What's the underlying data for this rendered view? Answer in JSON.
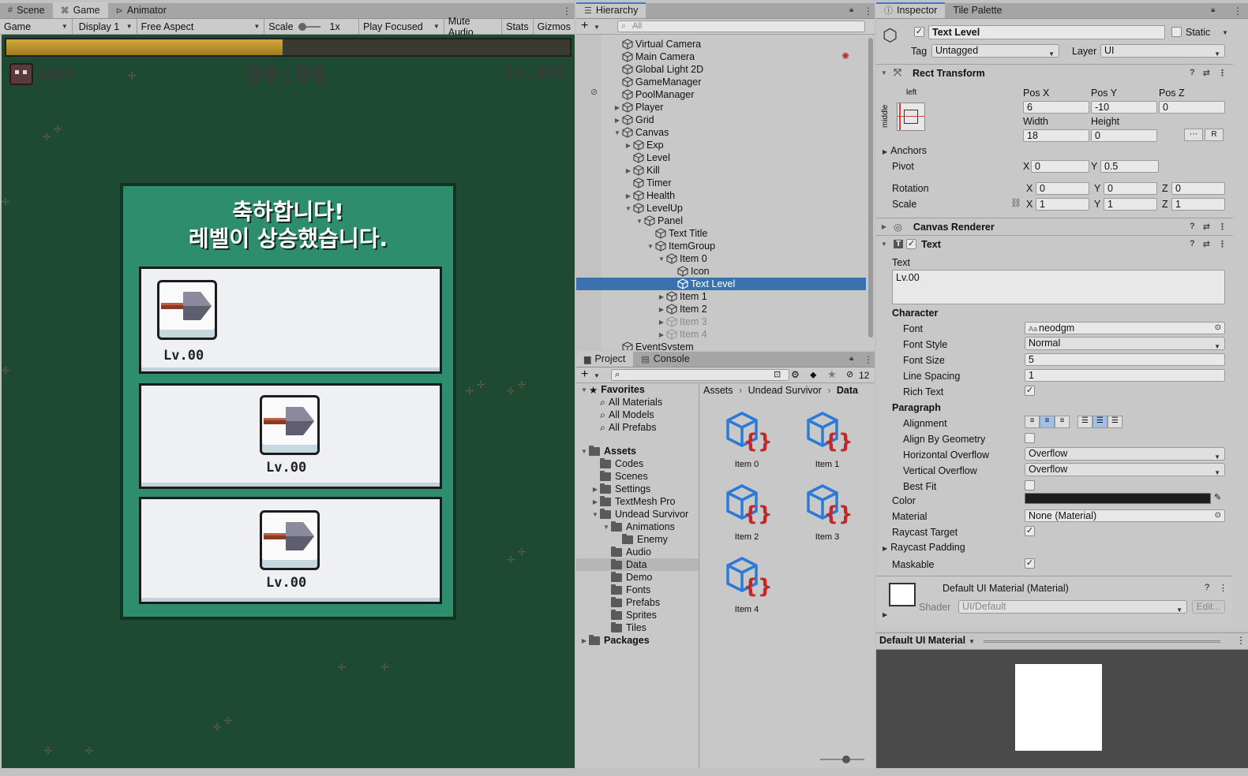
{
  "game": {
    "tabs": [
      {
        "label": "Scene"
      },
      {
        "label": "Game"
      },
      {
        "label": "Animator"
      }
    ],
    "toolbar": {
      "view": "Game",
      "display": "Display 1",
      "aspect": "Free Aspect",
      "scale_label": "Scale",
      "scale_value": "1x",
      "play_focused": "Play Focused",
      "mute": "Mute Audio",
      "stats": "Stats",
      "gizmos": "Gizmos"
    },
    "hud": {
      "kills": "9999",
      "timer": "00:00",
      "level": "Lv.999",
      "exp_fill": 0.49
    },
    "panel": {
      "title_line1": "축하합니다!",
      "title_line2": "레벨이 상승했습니다.",
      "items": [
        {
          "level": "Lv.00"
        },
        {
          "level": "Lv.00"
        },
        {
          "level": "Lv.00"
        }
      ]
    }
  },
  "hierarchy": {
    "tab": "Hierarchy",
    "search_placeholder": "All",
    "rows": [
      {
        "label": "Virtual Camera",
        "depth": 0,
        "fold": ""
      },
      {
        "label": "Main Camera",
        "depth": 0,
        "fold": ""
      },
      {
        "label": "Global Light 2D",
        "depth": 0,
        "fold": ""
      },
      {
        "label": "GameManager",
        "depth": 0,
        "fold": ""
      },
      {
        "label": "PoolManager",
        "depth": 0,
        "fold": ""
      },
      {
        "label": "Player",
        "depth": 0,
        "fold": "▶"
      },
      {
        "label": "Grid",
        "depth": 0,
        "fold": "▶"
      },
      {
        "label": "Canvas",
        "depth": 0,
        "fold": "▼"
      },
      {
        "label": "Exp",
        "depth": 1,
        "fold": "▶"
      },
      {
        "label": "Level",
        "depth": 1,
        "fold": ""
      },
      {
        "label": "Kill",
        "depth": 1,
        "fold": "▶"
      },
      {
        "label": "Timer",
        "depth": 1,
        "fold": ""
      },
      {
        "label": "Health",
        "depth": 1,
        "fold": "▶"
      },
      {
        "label": "LevelUp",
        "depth": 1,
        "fold": "▼"
      },
      {
        "label": "Panel",
        "depth": 2,
        "fold": "▼"
      },
      {
        "label": "Text Title",
        "depth": 3,
        "fold": ""
      },
      {
        "label": "ItemGroup",
        "depth": 3,
        "fold": "▼"
      },
      {
        "label": "Item 0",
        "depth": 4,
        "fold": "▼"
      },
      {
        "label": "Icon",
        "depth": 5,
        "fold": ""
      },
      {
        "label": "Text Level",
        "depth": 5,
        "fold": "",
        "selected": true
      },
      {
        "label": "Item 1",
        "depth": 4,
        "fold": "▶"
      },
      {
        "label": "Item 2",
        "depth": 4,
        "fold": "▶"
      },
      {
        "label": "Item 3",
        "depth": 4,
        "fold": "▶",
        "inactive": true
      },
      {
        "label": "Item 4",
        "depth": 4,
        "fold": "▶",
        "inactive": true
      },
      {
        "label": "EventSystem",
        "depth": 0,
        "fold": ""
      }
    ]
  },
  "project": {
    "tabs": [
      {
        "label": "Project"
      },
      {
        "label": "Console"
      }
    ],
    "hidden_count": "12",
    "favorites": {
      "label": "Favorites",
      "items": [
        "All Materials",
        "All Models",
        "All Prefabs"
      ]
    },
    "tree": [
      {
        "label": "Assets",
        "depth": 0,
        "fold": "▼",
        "bold": true
      },
      {
        "label": "Codes",
        "depth": 1,
        "fold": ""
      },
      {
        "label": "Scenes",
        "depth": 1,
        "fold": ""
      },
      {
        "label": "Settings",
        "depth": 1,
        "fold": "▶"
      },
      {
        "label": "TextMesh Pro",
        "depth": 1,
        "fold": "▶"
      },
      {
        "label": "Undead Survivor",
        "depth": 1,
        "fold": "▼"
      },
      {
        "label": "Animations",
        "depth": 2,
        "fold": "▼"
      },
      {
        "label": "Enemy",
        "depth": 3,
        "fold": ""
      },
      {
        "label": "Audio",
        "depth": 2,
        "fold": ""
      },
      {
        "label": "Data",
        "depth": 2,
        "fold": "",
        "selected": true
      },
      {
        "label": "Demo",
        "depth": 2,
        "fold": ""
      },
      {
        "label": "Fonts",
        "depth": 2,
        "fold": ""
      },
      {
        "label": "Prefabs",
        "depth": 2,
        "fold": ""
      },
      {
        "label": "Sprites",
        "depth": 2,
        "fold": ""
      },
      {
        "label": "Tiles",
        "depth": 2,
        "fold": ""
      },
      {
        "label": "Packages",
        "depth": 0,
        "fold": "▶",
        "bold": true
      }
    ],
    "breadcrumb": [
      "Assets",
      "Undead Survivor",
      "Data"
    ],
    "assets": [
      "Item 0",
      "Item 1",
      "Item 2",
      "Item 3",
      "Item 4"
    ]
  },
  "inspector": {
    "tabs": [
      {
        "label": "Inspector"
      },
      {
        "label": "Tile Palette"
      }
    ],
    "object_name": "Text Level",
    "static_label": "Static",
    "tag_label": "Tag",
    "tag": "Untagged",
    "layer_label": "Layer",
    "layer": "UI",
    "rect": {
      "title": "Rect Transform",
      "anchor_h": "left",
      "anchor_v": "middle",
      "posx_label": "Pos X",
      "posx": "6",
      "posy_label": "Pos Y",
      "posy": "-10",
      "posz_label": "Pos Z",
      "posz": "0",
      "width_label": "Width",
      "width": "18",
      "height_label": "Height",
      "height": "0",
      "r_button": "R",
      "anchors_label": "Anchors",
      "pivot_label": "Pivot",
      "pivot_x": "0",
      "pivot_y": "0.5",
      "rotation_label": "Rotation",
      "rot_x": "0",
      "rot_y": "0",
      "rot_z": "0",
      "scale_label": "Scale",
      "scale_x": "1",
      "scale_y": "1",
      "scale_z": "1",
      "x": "X",
      "y": "Y",
      "z": "Z"
    },
    "canvas_renderer": "Canvas Renderer",
    "text": {
      "title": "Text",
      "text_label": "Text",
      "text_value": "Lv.00",
      "character": "Character",
      "font_label": "Font",
      "font": "neodgm",
      "font_style_label": "Font Style",
      "font_style": "Normal",
      "font_size_label": "Font Size",
      "font_size": "5",
      "line_spacing_label": "Line Spacing",
      "line_spacing": "1",
      "rich_text_label": "Rich Text",
      "paragraph": "Paragraph",
      "alignment_label": "Alignment",
      "align_geom_label": "Align By Geometry",
      "h_overflow_label": "Horizontal Overflow",
      "h_overflow": "Overflow",
      "v_overflow_label": "Vertical Overflow",
      "v_overflow": "Overflow",
      "best_fit_label": "Best Fit",
      "color_label": "Color",
      "color": "#1e1e1e",
      "material_label": "Material",
      "material": "None (Material)",
      "raycast_label": "Raycast Target",
      "raycast_padding_label": "Raycast Padding",
      "maskable_label": "Maskable"
    },
    "material_block": {
      "name": "Default UI Material (Material)",
      "shader_label": "Shader",
      "shader": "UI/Default",
      "edit": "Edit..."
    },
    "preview": {
      "title": "Default UI Material"
    }
  },
  "colors": {
    "accent": "#3a79d7",
    "selection": "#3a72b0",
    "game_bg": "#1e4a34",
    "panel": "#2d8d6c"
  }
}
